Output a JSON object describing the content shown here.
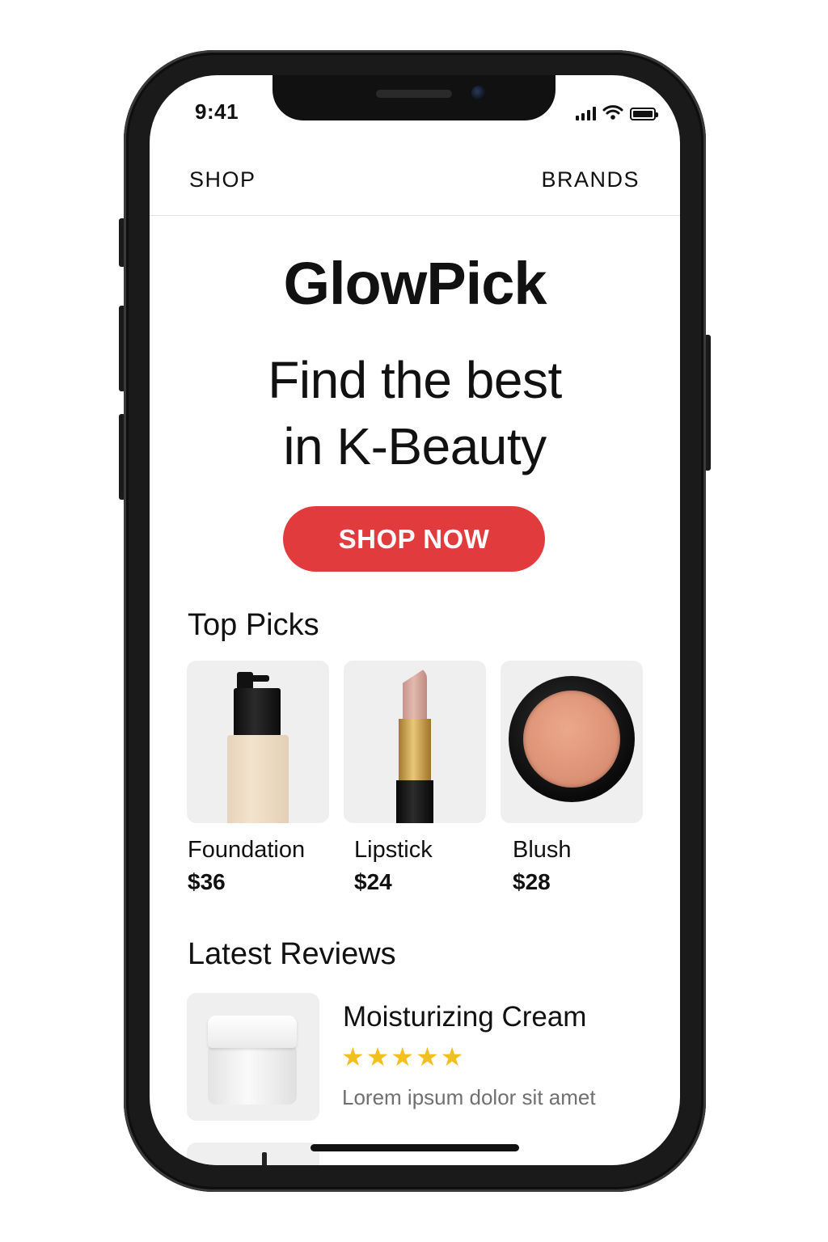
{
  "status_bar": {
    "time": "9:41",
    "icons": [
      "signal-icon",
      "wifi-icon",
      "battery-icon"
    ]
  },
  "nav": {
    "shop": "SHOP",
    "brands": "BRANDS"
  },
  "hero": {
    "brand": "GlowPick",
    "headline_line1": "Find the best",
    "headline_line2": "in K-Beauty",
    "cta": "SHOP NOW"
  },
  "top_picks": {
    "title": "Top Picks",
    "items": [
      {
        "name": "Foundation",
        "price": "$36",
        "image": "foundation-bottle"
      },
      {
        "name": "Lipstick",
        "price": "$24",
        "image": "lipstick"
      },
      {
        "name": "Blush",
        "price": "$28",
        "image": "blush-compact"
      }
    ]
  },
  "reviews": {
    "title": "Latest Reviews",
    "items": [
      {
        "name": "Moisturizing Cream",
        "rating": 5,
        "stars": "★★★★★",
        "text": "Lorem ipsum dolor sit amet",
        "image": "cream-jar"
      }
    ]
  },
  "colors": {
    "accent": "#e23b3d",
    "star": "#f2c01e",
    "text": "#111111",
    "muted_text": "#707070",
    "card_bg": "#efefef"
  }
}
